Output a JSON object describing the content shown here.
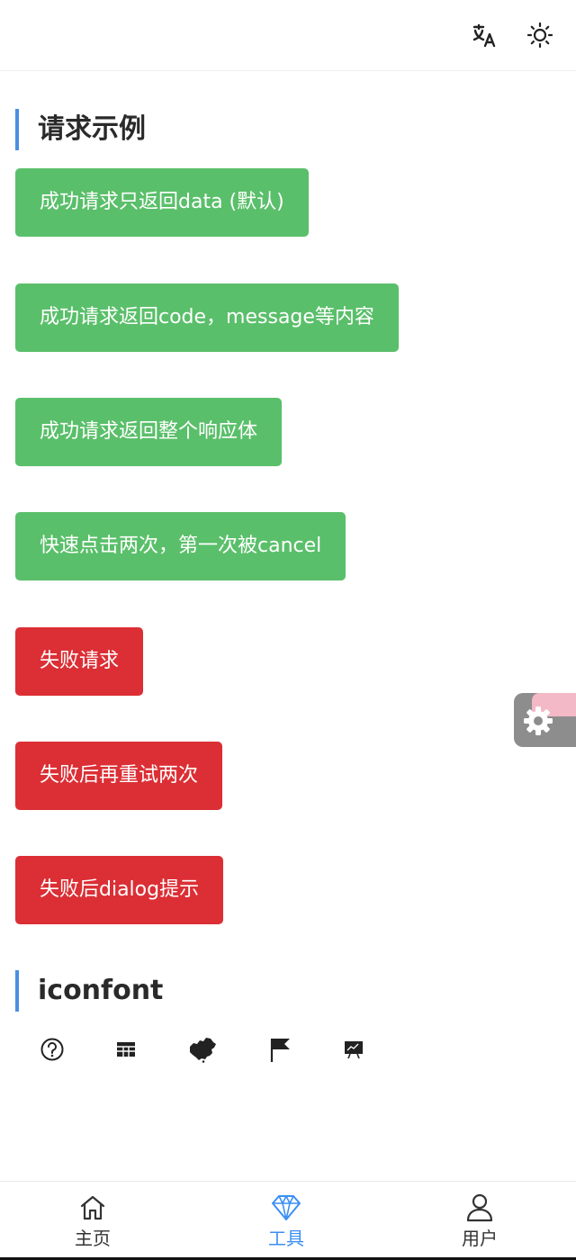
{
  "header": {
    "lang_icon": "translate-icon",
    "theme_icon": "sun-icon"
  },
  "sections": {
    "request": {
      "title": "请求示例"
    },
    "iconfont": {
      "title": "iconfont"
    }
  },
  "buttons": {
    "success_data": "成功请求只返回data (默认)",
    "success_code": "成功请求返回code，message等内容",
    "success_full": "成功请求返回整个响应体",
    "double_click": "快速点击两次，第一次被cancel",
    "fail": "失败请求",
    "fail_retry": "失败后再重试两次",
    "fail_dialog": "失败后dialog提示"
  },
  "iconfont_icons": [
    "question-circle-icon",
    "table-icon",
    "china-map-icon",
    "flag-icon",
    "presentation-chart-icon"
  ],
  "floating_button": {
    "icon": "settings-icon"
  },
  "tabbar": {
    "items": [
      {
        "label": "主页",
        "icon": "home-icon"
      },
      {
        "label": "工具",
        "icon": "diamond-icon",
        "active": true
      },
      {
        "label": "用户",
        "icon": "user-icon"
      }
    ]
  },
  "colors": {
    "accent": "#3b8ff3",
    "success": "#5abf6a",
    "danger": "#db2f35",
    "section_bar": "#4a90e2"
  }
}
